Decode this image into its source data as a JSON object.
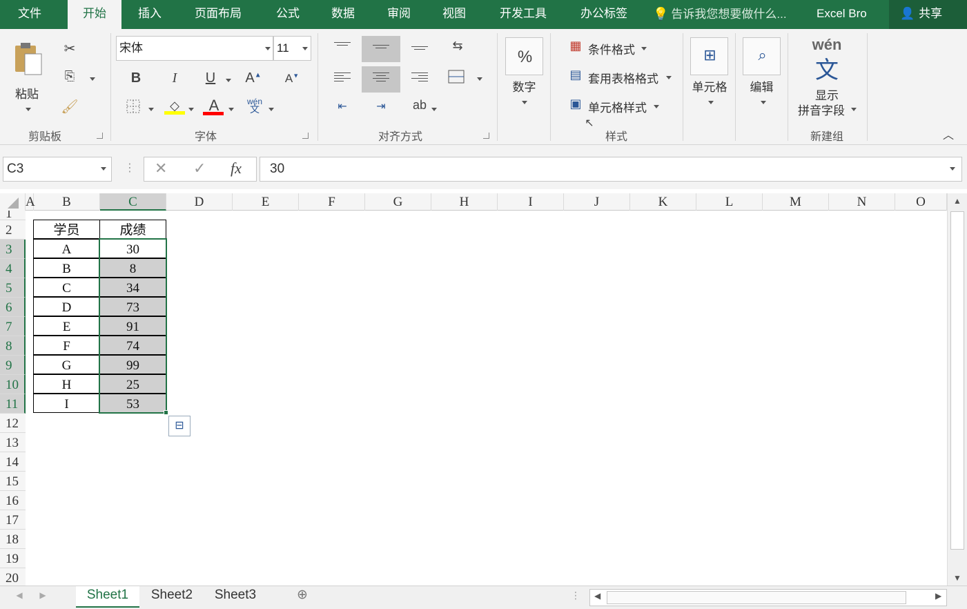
{
  "tabs": {
    "file": "文件",
    "home": "开始",
    "insert": "插入",
    "layout": "页面布局",
    "formulas": "公式",
    "data": "数据",
    "review": "审阅",
    "view": "视图",
    "developer": "开发工具",
    "office": "办公标签"
  },
  "tell_me": "告诉我您想要做什么...",
  "account": "Excel Bro",
  "share": "共享",
  "ribbon": {
    "paste": "粘贴",
    "clipboard": "剪贴板",
    "font_name": "宋体",
    "font_size": "11",
    "font_group": "字体",
    "bold": "B",
    "italic": "I",
    "underline": "U",
    "align_group": "对齐方式",
    "number": "数字",
    "cond_format": "条件格式",
    "table_format": "套用表格格式",
    "cell_style": "单元格样式",
    "styles_group": "样式",
    "cells": "单元格",
    "edit": "编辑",
    "wen_top": "wén",
    "wen_char": "文",
    "show_pinyin_1": "显示",
    "show_pinyin_2": "拼音字段",
    "new_group": "新建组"
  },
  "formula_bar": {
    "name_box": "C3",
    "value": "30",
    "fx": "fx"
  },
  "columns": [
    "A",
    "B",
    "C",
    "D",
    "E",
    "F",
    "G",
    "H",
    "I",
    "J",
    "K",
    "L",
    "M",
    "N",
    "O"
  ],
  "rows": [
    "1",
    "2",
    "3",
    "4",
    "5",
    "6",
    "7",
    "8",
    "9",
    "10",
    "11",
    "12",
    "13",
    "14",
    "15",
    "16",
    "17",
    "18",
    "19",
    "20"
  ],
  "table": {
    "header": [
      "学员",
      "成绩"
    ],
    "rows": [
      [
        "A",
        "30"
      ],
      [
        "B",
        "8"
      ],
      [
        "C",
        "34"
      ],
      [
        "D",
        "73"
      ],
      [
        "E",
        "91"
      ],
      [
        "F",
        "74"
      ],
      [
        "G",
        "99"
      ],
      [
        "H",
        "25"
      ],
      [
        "I",
        "53"
      ]
    ]
  },
  "sheets": [
    "Sheet1",
    "Sheet2",
    "Sheet3"
  ],
  "colors": {
    "excel_green": "#217346",
    "selection_gray": "#d0d0d0"
  }
}
